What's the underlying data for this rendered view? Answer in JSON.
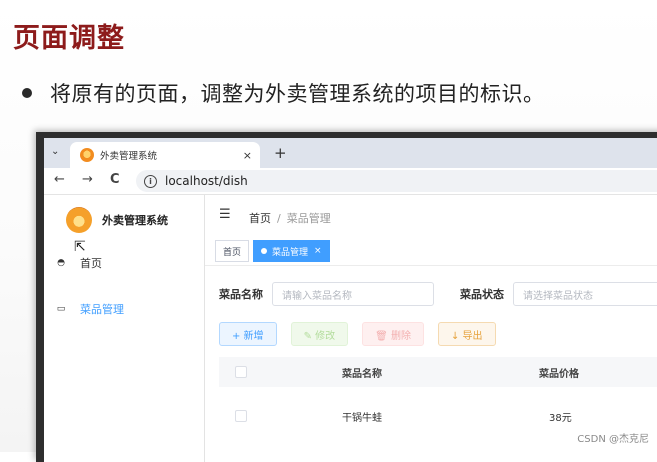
{
  "slide": {
    "title": "页面调整",
    "bullet": "将原有的页面，调整为外卖管理系统的项目的标识。"
  },
  "browser": {
    "tab_title": "外卖管理系统",
    "tab_close": "×",
    "new_tab": "+",
    "tab_menu": "⌄",
    "url": "localhost/dish",
    "back": "←",
    "forward": "→",
    "reload": "C"
  },
  "app": {
    "brand": "外卖管理系统",
    "menu": [
      {
        "label": "首页",
        "icon": "dashboard-icon"
      },
      {
        "label": "菜品管理",
        "icon": "dish-icon"
      }
    ],
    "breadcrumb": {
      "home": "首页",
      "separator": "/",
      "current": "菜品管理"
    },
    "tags": [
      {
        "label": "首页",
        "active": false
      },
      {
        "label": "菜品管理",
        "active": true
      }
    ],
    "filters": {
      "name_label": "菜品名称",
      "name_placeholder": "请输入菜品名称",
      "status_label": "菜品状态",
      "status_placeholder": "请选择菜品状态"
    },
    "buttons": {
      "add": "+ 新增",
      "edit": "✎ 修改",
      "delete": "🗑 删除",
      "export": "↓ 导出"
    },
    "table": {
      "columns": [
        "菜品名称",
        "菜品价格"
      ],
      "rows": [
        {
          "name": "干锅牛蛙",
          "price": "38元"
        }
      ]
    },
    "accent_color": "#409eff"
  },
  "watermark": "CSDN @杰克尼"
}
